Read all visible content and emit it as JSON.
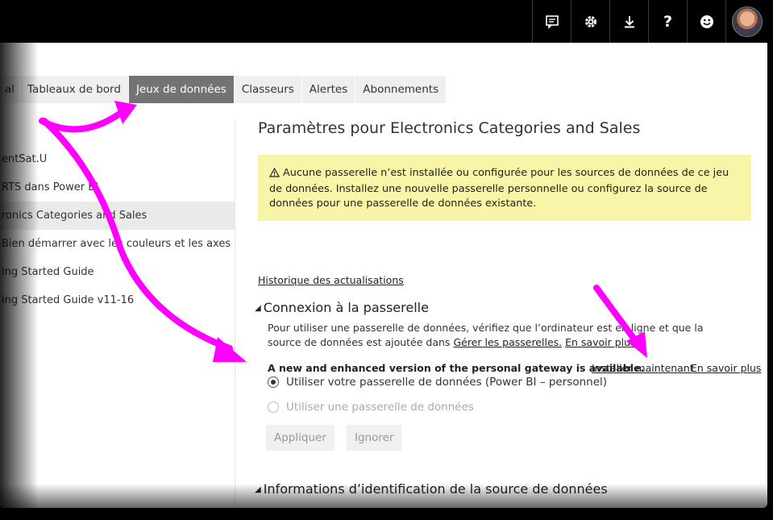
{
  "topbar": {
    "buttons": [
      {
        "name": "feedback-icon"
      },
      {
        "name": "gear-icon"
      },
      {
        "name": "download-icon"
      },
      {
        "name": "help-icon"
      },
      {
        "name": "smiley-icon"
      }
    ]
  },
  "tabs": [
    {
      "label": "al"
    },
    {
      "label": "Tableaux de bord"
    },
    {
      "label": "Jeux de données",
      "active": true
    },
    {
      "label": "Classeurs"
    },
    {
      "label": "Alertes"
    },
    {
      "label": "Abonnements"
    }
  ],
  "sidebar": {
    "items": [
      {
        "label": "entSat.U"
      },
      {
        "label": "RTS dans Power BI"
      },
      {
        "label": "ronics Categories and Sales",
        "selected": true
      },
      {
        "label": "Bien démarrer avec les couleurs et les axes"
      },
      {
        "label": "ing Started Guide"
      },
      {
        "label": "ing Started Guide v11-16"
      }
    ]
  },
  "main": {
    "title": "Paramètres pour Electronics Categories and Sales",
    "warning": "Aucune passerelle n’est installée ou configurée pour les sources de données de ce jeu de données. Installez une nouvelle passerelle personnelle ou configurez la source de données pour une passerelle de données existante.",
    "history_link": "Historique des actualisations",
    "gateway_section": {
      "heading": "Connexion à la passerelle",
      "desc_prefix": "Pour utiliser une passerelle de données, vérifiez que l’ordinateur est en ligne et que la source de données est ajoutée dans",
      "manage_link": "Gérer les passerelles.",
      "learn_link": "En savoir plus",
      "notice": "A new and enhanced version of the personal gateway is available.",
      "install_link": "Installer maintenant",
      "notice_learn_link": "En savoir plus",
      "option_personal": "Utiliser votre passerelle de données (Power BI – personnel)",
      "option_gateway": "Utiliser une passerelle de données",
      "apply_button": "Appliquer",
      "ignore_button": "Ignorer"
    },
    "credentials_heading": "Informations d’identification de la source de données"
  },
  "colors": {
    "highlight_arrow": "#ff00ff",
    "warning_bg": "#f8f4a8",
    "active_tab": "#737373"
  }
}
